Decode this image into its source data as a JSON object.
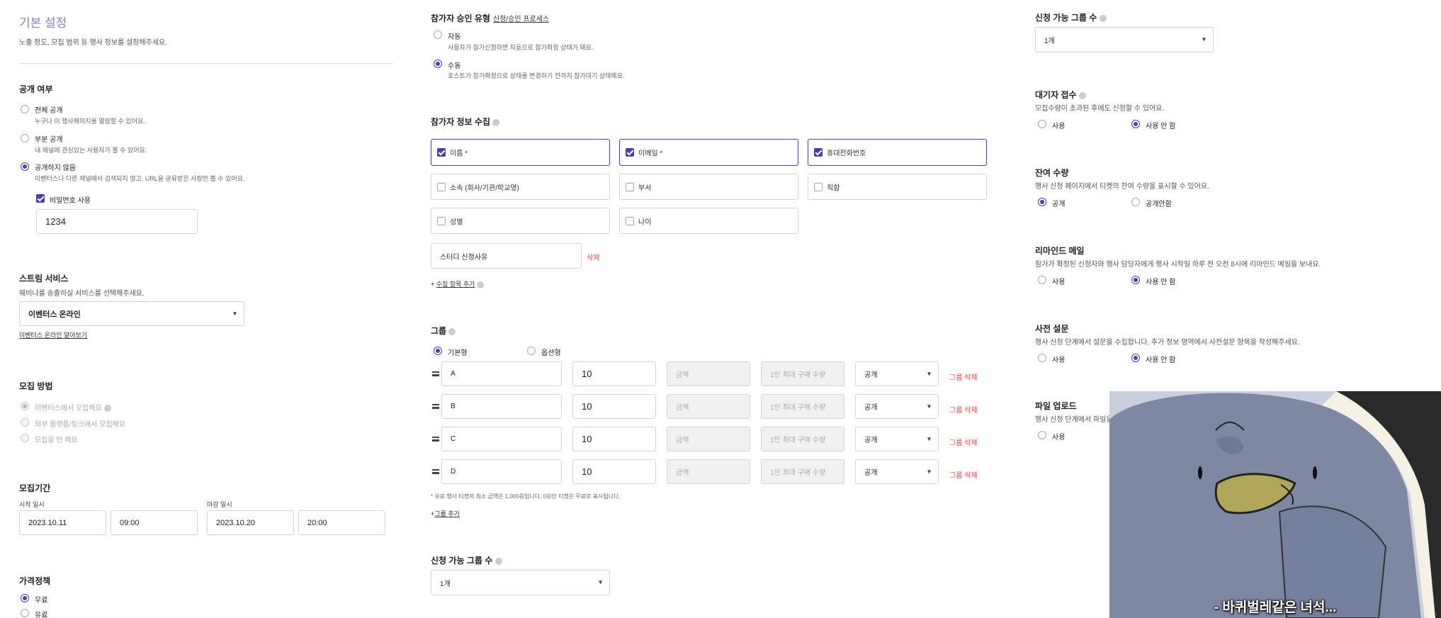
{
  "left": {
    "title": "기본 설정",
    "subtitle": "노출 정도, 모집 범위 등 행사 정보를 설정해주세요.",
    "visibility": {
      "title": "공개 여부",
      "options": [
        {
          "label": "전체 공개",
          "desc": "누구나 이 행사페이지를 열람할 수 있어요."
        },
        {
          "label": "부분 공개",
          "desc": "내 채널에 관심있는 사용자가 볼 수 있어요."
        },
        {
          "label": "공개하지 않음",
          "desc": "이벤터스나 다른 채널에서 검색되지 않고, URL을 공유받은 사람만 볼 수 있어요."
        }
      ],
      "password_label": "비밀번호 사용",
      "password_value": "1234"
    },
    "stream": {
      "title": "스트림 서비스",
      "desc": "웨비나를 송출하실 서비스를 선택해주세요.",
      "selected": "이벤터스 온라인",
      "link": "이벤터스 온라인 알아보기"
    },
    "recruit": {
      "title": "모집 방법",
      "options": [
        "이벤터스에서 모집해요",
        "외부 플랫폼/링크에서 모집해요",
        "모집을 안 해요"
      ]
    },
    "period": {
      "title": "모집기간",
      "start_label": "시작 일시",
      "end_label": "마감 일시",
      "start_date": "2023.10.11",
      "start_time": "09:00",
      "end_date": "2023.10.20",
      "end_time": "20:00"
    },
    "price": {
      "title": "가격정책",
      "options": [
        "무료",
        "유료"
      ]
    }
  },
  "mid": {
    "approval": {
      "title": "참가자 승인 유형",
      "link": "신청/승인 프로세스",
      "options": [
        {
          "label": "자동",
          "desc": "사용자가 참가신청하면 자동으로 참가확정 상태가 돼요."
        },
        {
          "label": "수동",
          "desc": "호스트가 참가확정으로 상태를 변경하기 전까지 참가대기 상태예요."
        }
      ]
    },
    "info": {
      "title": "참가자 정보 수집",
      "fields": [
        "이름 *",
        "이메일 *",
        "휴대전화번호",
        "소속 (회사/기관/학교명)",
        "부서",
        "직함",
        "성별",
        "나이"
      ],
      "custom_field": "스터디 신청사유",
      "delete": "삭제",
      "add_link": "수집 항목 추가"
    },
    "group": {
      "title": "그룹",
      "types": [
        "기본형",
        "옵션형"
      ],
      "rows": [
        {
          "name": "A",
          "qty": "10"
        },
        {
          "name": "B",
          "qty": "10"
        },
        {
          "name": "C",
          "qty": "10"
        },
        {
          "name": "D",
          "qty": "10"
        }
      ],
      "price_placeholder": "금액",
      "max_placeholder": "1인 최대 구매 수량",
      "visibility": "공개",
      "delete": "그룹 삭제",
      "note": "* 유료 행사 티켓의 최소 금액은 1,000원입니다. 0원인 티켓은 무료로 표시됩니다.",
      "add_link": "그룹 추가"
    },
    "group_count": {
      "title": "신청 가능 그룹 수",
      "selected": "1개"
    }
  },
  "right": {
    "group_count": {
      "title": "신청 가능 그룹 수",
      "selected": "1개"
    },
    "waitlist": {
      "title": "대기자 접수",
      "desc": "모집수량이 초과된 후에도 신청할 수 있어요.",
      "options": [
        "사용",
        "사용 안 함"
      ]
    },
    "remaining": {
      "title": "잔여 수량",
      "desc": "행사 신청 페이지에서 티켓의 잔여 수량을 표시할 수 있어요.",
      "options": [
        "공개",
        "공개안함"
      ]
    },
    "reminder": {
      "title": "리마인드 메일",
      "desc": "참가가 확정된 신청자와 행사 담당자에게 행사 시작일 하루 전 오전 8시에 리마인드 메일을 보내요.",
      "options": [
        "사용",
        "사용 안 함"
      ]
    },
    "survey": {
      "title": "사전 설문",
      "desc": "행사 신청 단계에서 설문을 수집합니다. 추가 정보 영역에서 사전설문 항목을 작성해주세요.",
      "options": [
        "사용",
        "사용 안 함"
      ]
    },
    "upload": {
      "title": "파일 업로드",
      "desc": "행사 신청 단계에서 파일을",
      "options": [
        "사용"
      ]
    }
  },
  "overlay": {
    "caption": "- 바퀴벌레같은 녀석..."
  }
}
